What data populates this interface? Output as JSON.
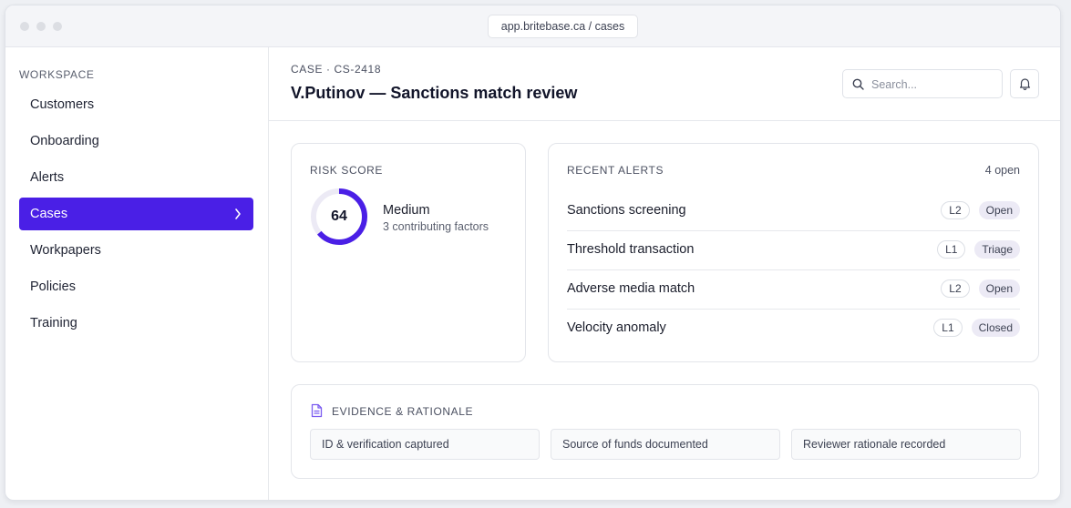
{
  "browser": {
    "url": "app.britebase.ca / cases"
  },
  "sidebar": {
    "section_label": "WORKSPACE",
    "items": [
      {
        "label": "Customers",
        "active": false
      },
      {
        "label": "Onboarding",
        "active": false
      },
      {
        "label": "Alerts",
        "active": false
      },
      {
        "label": "Cases",
        "active": true
      },
      {
        "label": "Workpapers",
        "active": false
      },
      {
        "label": "Policies",
        "active": false
      },
      {
        "label": "Training",
        "active": false
      }
    ]
  },
  "header": {
    "case_id": "CASE · CS-2418",
    "title": "V.Putinov — Sanctions match review",
    "search_placeholder": "Search..."
  },
  "risk": {
    "label": "RISK SCORE",
    "score": "64",
    "score_value": 64,
    "score_max": 100,
    "level": "Medium",
    "subtitle": "3 contributing factors"
  },
  "alerts": {
    "label": "RECENT ALERTS",
    "count": "4 open",
    "items": [
      {
        "title": "Sanctions screening",
        "level": "L2",
        "status": "Open"
      },
      {
        "title": "Threshold transaction",
        "level": "L1",
        "status": "Triage"
      },
      {
        "title": "Adverse media match",
        "level": "L2",
        "status": "Open"
      },
      {
        "title": "Velocity anomaly",
        "level": "L1",
        "status": "Closed"
      }
    ]
  },
  "evidence": {
    "label": "EVIDENCE & RATIONALE",
    "items": [
      "ID & verification captured",
      "Source of funds documented",
      "Reviewer rationale recorded"
    ]
  },
  "colors": {
    "accent": "#4a1fe6",
    "gauge_track": "#eceaf5",
    "status_pill": "#eceaf5"
  }
}
